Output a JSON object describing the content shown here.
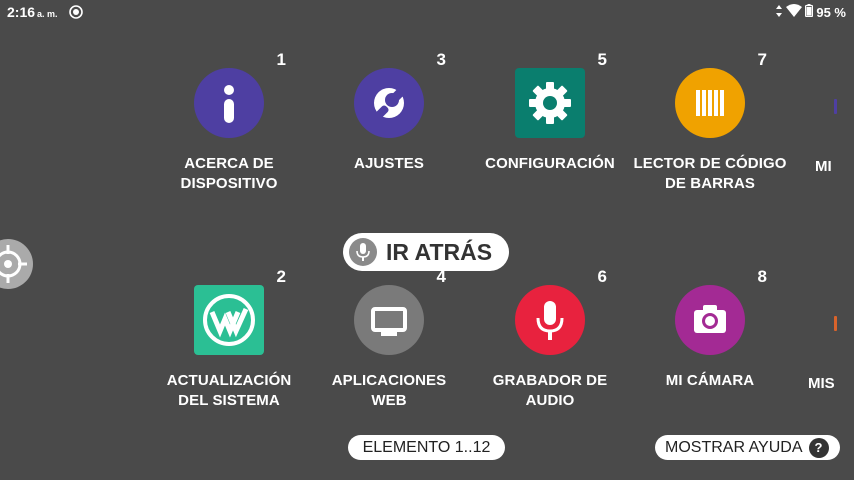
{
  "status": {
    "time": "2:16",
    "ampm": "a. m.",
    "battery": "95 %"
  },
  "tiles": [
    {
      "number": "1",
      "label_line1": "ACERCA DE",
      "label_line2": "DISPOSITIVO",
      "icon": "info-icon",
      "color": "#4e3fa2"
    },
    {
      "number": "3",
      "label_line1": "AJUSTES",
      "label_line2": "",
      "icon": "wrench-icon",
      "color": "#4e3fa2"
    },
    {
      "number": "5",
      "label_line1": "CONFIGURACIÓN",
      "label_line2": "",
      "icon": "gear-icon",
      "color": "#0a7e6e"
    },
    {
      "number": "7",
      "label_line1": "LECTOR DE CÓDIGO",
      "label_line2": "DE BARRAS",
      "icon": "barcode-icon",
      "color": "#f0a200"
    },
    {
      "number": "2",
      "label_line1": "ACTUALIZACIÓN",
      "label_line2": "DEL SISTEMA",
      "icon": "system-update-icon",
      "color": "#2bbf94"
    },
    {
      "number": "4",
      "label_line1": "APLICACIONES",
      "label_line2": "WEB",
      "icon": "monitor-icon",
      "color": "#7a7a7a"
    },
    {
      "number": "6",
      "label_line1": "GRABADOR DE",
      "label_line2": "AUDIO",
      "icon": "microphone-icon",
      "color": "#e8223e"
    },
    {
      "number": "8",
      "label_line1": "MI CÁMARA",
      "label_line2": "",
      "icon": "camera-icon",
      "color": "#a32a94"
    }
  ],
  "partial_top": "MI",
  "partial_bottom": "MIS",
  "go_back_label": "IR ATRÁS",
  "items_label": "ELEMENTO 1..12",
  "help_label": "MOSTRAR AYUDA",
  "help_symbol": "?"
}
